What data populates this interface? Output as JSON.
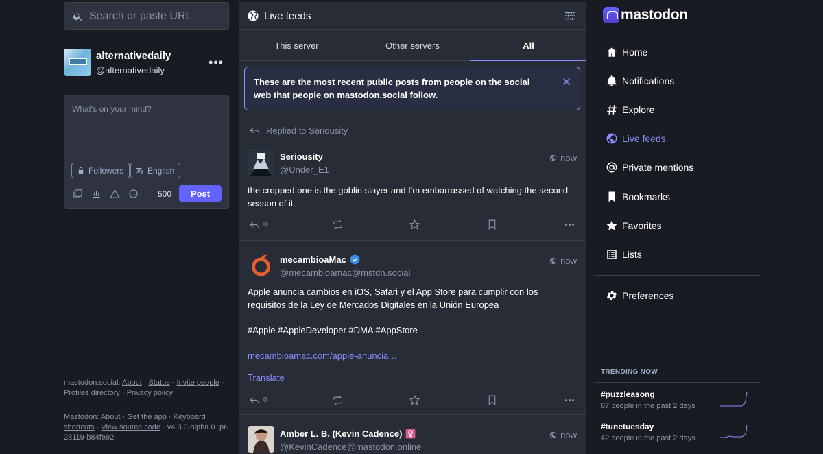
{
  "left": {
    "search_placeholder": "Search or paste URL",
    "account": {
      "name": "alternativedaily",
      "handle": "@alternativedaily"
    },
    "compose": {
      "placeholder": "What's on your mind?",
      "visibility": "Followers",
      "language": "English",
      "char_count": "500",
      "post_label": "Post"
    },
    "footer": {
      "server_prefix": "mastodon.social:",
      "about": "About",
      "status": "Status",
      "invite": "Invite people",
      "profiles": "Profiles directory",
      "privacy": "Privacy policy",
      "mastodon_prefix": "Mastodon:",
      "about2": "About",
      "get_app": "Get the app",
      "keyboard": "Keyboard shortcuts",
      "source": "View source code",
      "version": "v4.3.0-alpha.0+pr-28119-b84fe92"
    }
  },
  "center": {
    "title": "Live feeds",
    "tabs": [
      "This server",
      "Other servers",
      "All"
    ],
    "banner": "These are the most recent public posts from people on the social web that people on mastodon.social follow.",
    "posts": [
      {
        "replied": "Replied to Seriousity",
        "name": "Seriousity",
        "handle": "@Under_E1",
        "time": "now",
        "text": "the cropped one is the goblin slayer and I'm embarrassed of watching the second season of it.",
        "replies": "0"
      },
      {
        "name": "mecambioaMac",
        "handle": "@mecambioamac@mstdn.social",
        "time": "now",
        "text1": "Apple anuncia cambios en iOS, Safari y el App Store para cumplir con los requisitos de la Ley de Mercados Digitales en la Unión Europea",
        "text2": "#Apple #AppleDeveloper #DMA #AppStore",
        "link": "mecambioamac.com/apple-anuncia…",
        "translate": "Translate",
        "replies": "0"
      },
      {
        "name": "Amber L. B. (Kevin Cadence)",
        "handle": "@KevinCadence@mastodon.online",
        "time": "now"
      }
    ]
  },
  "right": {
    "logo": "mastodon",
    "nav": [
      "Home",
      "Notifications",
      "Explore",
      "Live feeds",
      "Private mentions",
      "Bookmarks",
      "Favorites",
      "Lists"
    ],
    "preferences": "Preferences",
    "trending_title": "TRENDING NOW",
    "trends": [
      {
        "tag": "#puzzleasong",
        "sub": "87 people in the past 2 days"
      },
      {
        "tag": "#tunetuesday",
        "sub": "42 people in the past 2 days"
      }
    ]
  },
  "colors": {
    "background": "#191b22",
    "panel": "#282c37",
    "accent": "#8c8dff",
    "button": "#6364ff"
  }
}
